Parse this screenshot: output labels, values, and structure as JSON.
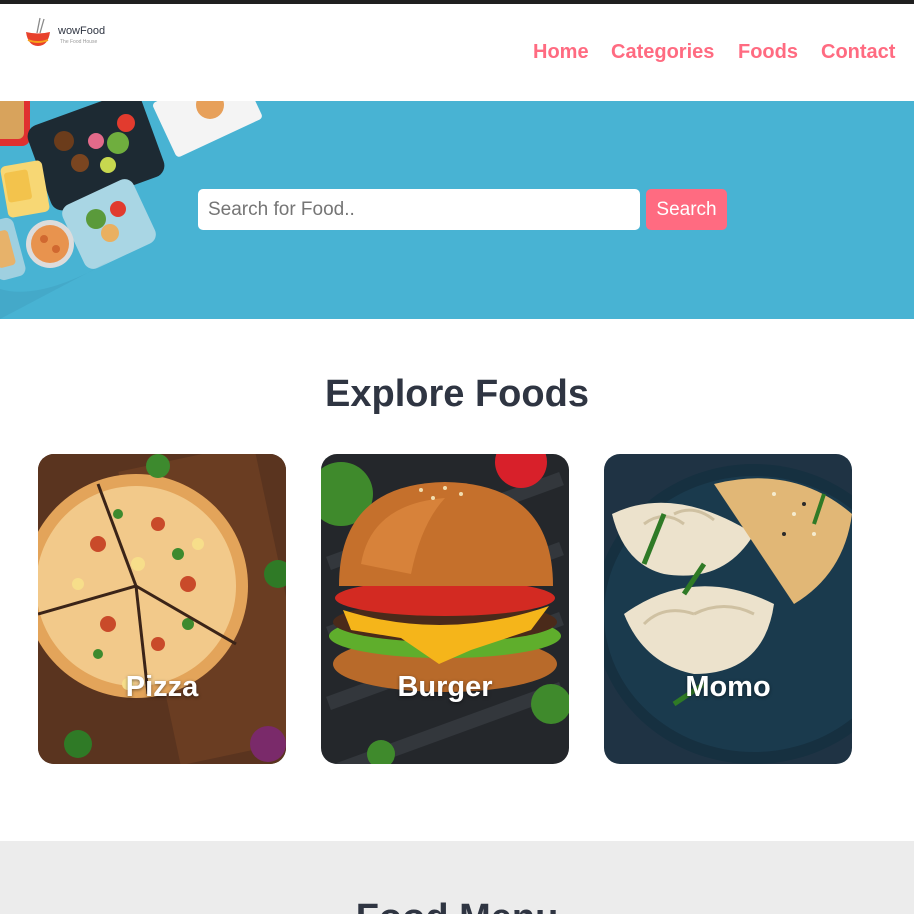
{
  "brand": {
    "name": "wowFood",
    "tagline": "The Food House"
  },
  "nav": {
    "items": [
      "Home",
      "Categories",
      "Foods",
      "Contact"
    ]
  },
  "search": {
    "placeholder": "Search for Food..",
    "value": "",
    "button_label": "Search"
  },
  "explore": {
    "title": "Explore Foods",
    "categories": [
      {
        "label": "Pizza",
        "image": "pizza-image"
      },
      {
        "label": "Burger",
        "image": "burger-image"
      },
      {
        "label": "Momo",
        "image": "momo-image"
      }
    ]
  },
  "menu": {
    "title": "Food Menu"
  },
  "colors": {
    "accent": "#ff6b81",
    "hero_bg": "#48b3d3",
    "heading": "#2f3542",
    "menu_bg": "#ececec"
  }
}
